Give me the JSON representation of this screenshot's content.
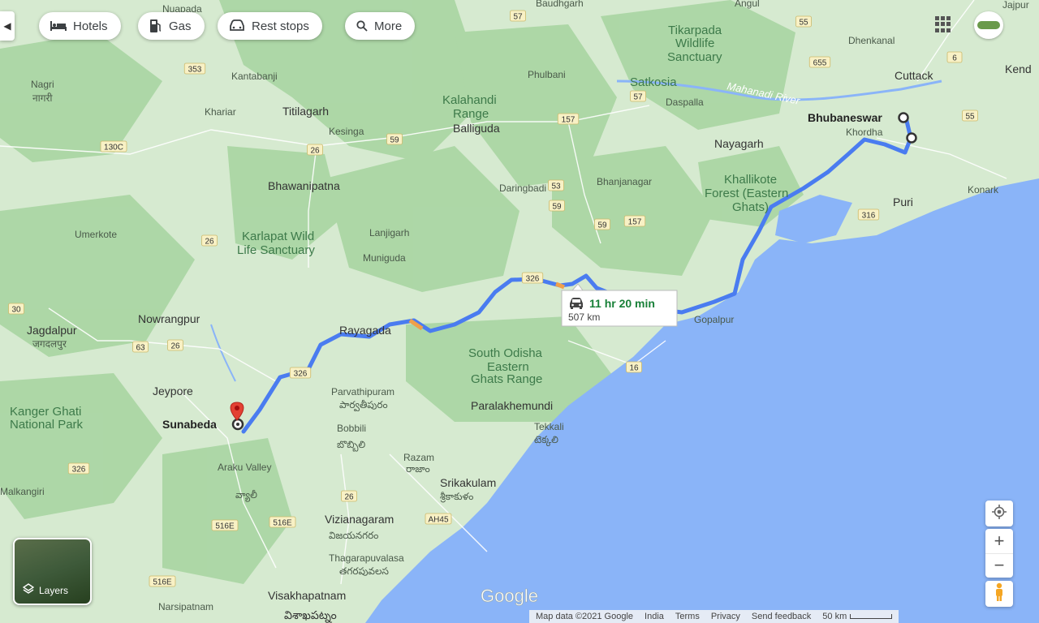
{
  "toolbar": {
    "hotels": "Hotels",
    "gas": "Gas",
    "rest_stops": "Rest stops",
    "more": "More"
  },
  "route": {
    "duration": "11 hr 20 min",
    "distance": "507 km",
    "origin": "Sunabeda",
    "destination": "Bhubaneswar"
  },
  "layers": {
    "label": "Layers"
  },
  "google_logo": "Google",
  "footer": {
    "map_data": "Map data ©2021 Google",
    "country": "India",
    "terms": "Terms",
    "privacy": "Privacy",
    "feedback": "Send feedback",
    "scale": "50 km"
  },
  "places": {
    "nuapada": "Nuapada",
    "baudhgarh": "Baudhgarh",
    "angul": "Angul",
    "jajpur": "Jajpur",
    "dhenkanal": "Dhenkanal",
    "tikarpada": "Tikarpada",
    "wildlife": "Wildlife",
    "sanctuary": "Sanctuary",
    "cuttack": "Cuttack",
    "kend": "Kend",
    "nagri": "Nagri",
    "nagri_hi": "नागरी",
    "kantabanji": "Kantabanji",
    "phulbani": "Phulbani",
    "satkosia": "Satkosia",
    "kalahandi": "Kalahandi",
    "range": "Range",
    "daspalla": "Daspalla",
    "mahanadi": "Mahanadi River",
    "kharial": "Khariar",
    "titilagarh": "Titilagarh",
    "balliguda": "Balliguda",
    "bhubaneswar": "Bhubaneswar",
    "kesinga": "Kesinga",
    "khordha": "Khordha",
    "nayagarh": "Nayagarh",
    "bhawanipatna": "Bhawanipatna",
    "daringbadi": "Daringbadi",
    "bhanjanagar": "Bhanjanagar",
    "khallikote": "Khallikote",
    "forest": "Forest (Eastern",
    "ghats": "Ghats)",
    "puri": "Puri",
    "konark": "Konark",
    "umerkote": "Umerkote",
    "karlapat": "Karlapat Wild",
    "life_sanctuary": "Life Sanctuary",
    "lanjigarh": "Lanjigarh",
    "muniguda": "Muniguda",
    "nowrangpur": "Nowrangpur",
    "jagdalpur": "Jagdalpur",
    "jagdalpur_hi": "जगदलपुर",
    "rayagada": "Rayagada",
    "gopalpur": "Gopalpur",
    "south_odisha": "South Odisha",
    "eastern": "Eastern",
    "ghats_range": "Ghats Range",
    "jeypore": "Jeypore",
    "parvathipuram": "Parvathipuram",
    "parvathipuram_te": "పార్వతీపురం",
    "paralakhemundi": "Paralakhemundi",
    "tekkali": "Tekkali",
    "tekkali_te": "టెక్కలి",
    "kanger": "Kanger Ghati",
    "national_park": "National Park",
    "sunabeda": "Sunabeda",
    "bobbili": "Bobbili",
    "bobbili_te": "బొబ్బిలి",
    "razam": "Razam",
    "razam_te": "రాజాం",
    "araku": "Araku Valley",
    "araku_te": "వ్యాలీ",
    "srikakulam": "Srikakulam",
    "srikakulam_te": "శ్రీకాకుళం",
    "malkangiri": "Malkangiri",
    "vizianagaram": "Vizianagaram",
    "vizianagaram_te": "విజయనగరం",
    "thagarapuvalasa": "Thagarapuvalasa",
    "thagarapuvalasa_te": "తగరపువలస",
    "narsipatnam": "Narsipatnam",
    "visakhapatnam": "Visakhapatnam",
    "visakhapatnam_te": "విశాఖపట్నం"
  },
  "road_shields": [
    "57",
    "55",
    "353",
    "655",
    "6",
    "57",
    "157",
    "55",
    "130C",
    "26",
    "59",
    "53",
    "59",
    "157",
    "316",
    "26",
    "59",
    "326",
    "30",
    "63",
    "26",
    "326",
    "16",
    "326",
    "26",
    "AH45",
    "516E",
    "516E",
    "516E"
  ],
  "colors": {
    "route": "#4a7cf0",
    "route_alt": "#f0a04a",
    "sea": "#8ab4f8",
    "land": "#cfe7c9",
    "park": "#9fcf9c",
    "pin": "#e34133",
    "duration_text": "#188038"
  }
}
